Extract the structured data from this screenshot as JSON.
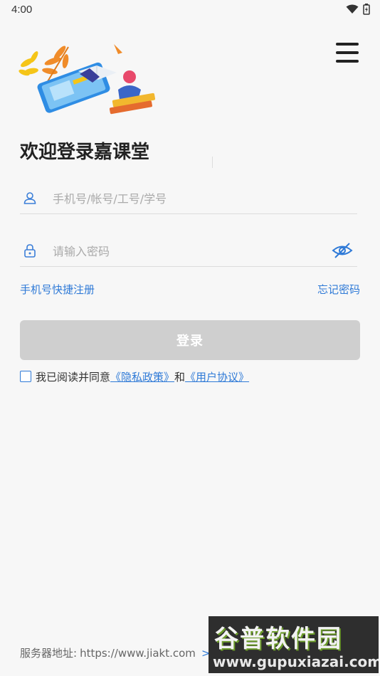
{
  "status_bar": {
    "time": "4:00"
  },
  "header": {
    "menu_icon": "hamburger-menu-icon"
  },
  "welcome": {
    "title": "欢迎登录嘉课堂"
  },
  "form": {
    "account_placeholder": "手机号/帐号/工号/学号",
    "account_value": "",
    "password_placeholder": "请输入密码",
    "password_value": "",
    "register_link": "手机号快捷注册",
    "forgot_link": "忘记密码",
    "login_button": "登录"
  },
  "agreement": {
    "text_prefix": "我已阅读并同意",
    "privacy_link": "《隐私政策》",
    "and": "和",
    "user_link": "《用户协议》"
  },
  "server": {
    "label": "服务器地址:",
    "url": "https://www.jiakt.com",
    "chevron": ">"
  },
  "watermark": {
    "title": "谷普软件园",
    "url": "www.gupuxiazai.com"
  },
  "colors": {
    "accent": "#2f7ad7",
    "login_disabled": "#cfcfcf",
    "background": "#f7f7f7"
  }
}
